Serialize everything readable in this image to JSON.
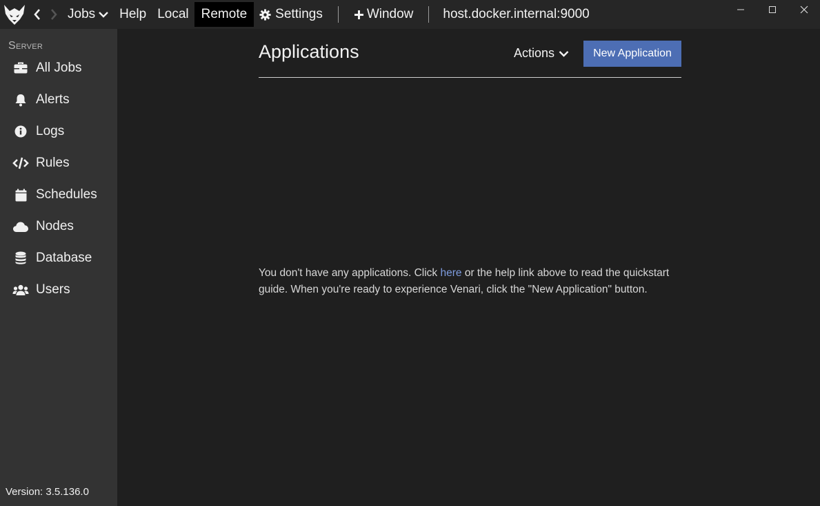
{
  "titlebar": {
    "menu": {
      "jobs": "Jobs",
      "help": "Help",
      "local": "Local",
      "remote": "Remote",
      "settings": "Settings",
      "window": "Window"
    },
    "host": "host.docker.internal:9000",
    "icons": [
      "venari-logo-icon",
      "back-arrow-icon",
      "forward-arrow-icon",
      "chevron-down-icon",
      "gear-icon",
      "plus-icon",
      "minimize-icon",
      "maximize-icon",
      "close-icon"
    ]
  },
  "sidebar": {
    "heading": "Server",
    "items": [
      {
        "label": "All Jobs",
        "icon": "briefcase-icon"
      },
      {
        "label": "Alerts",
        "icon": "bell-icon"
      },
      {
        "label": "Logs",
        "icon": "info-icon"
      },
      {
        "label": "Rules",
        "icon": "code-icon"
      },
      {
        "label": "Schedules",
        "icon": "calendar-icon"
      },
      {
        "label": "Nodes",
        "icon": "cloud-icon"
      },
      {
        "label": "Database",
        "icon": "database-icon"
      },
      {
        "label": "Users",
        "icon": "users-icon"
      }
    ],
    "version": "Version: 3.5.136.0"
  },
  "main": {
    "title": "Applications",
    "actions_label": "Actions",
    "new_app_label": "New Application",
    "empty": {
      "before": "You don't have any applications. Click ",
      "link": "here",
      "after": " or the help link above to read the quickstart guide. When you're ready to experience Venari, click the \"New Application\" button."
    }
  },
  "colors": {
    "background": "#1f1f1f",
    "sidebar": "#333333",
    "titlebar": "#262626",
    "accent_button": "#4d6eb4",
    "link": "#7e9cdf"
  }
}
